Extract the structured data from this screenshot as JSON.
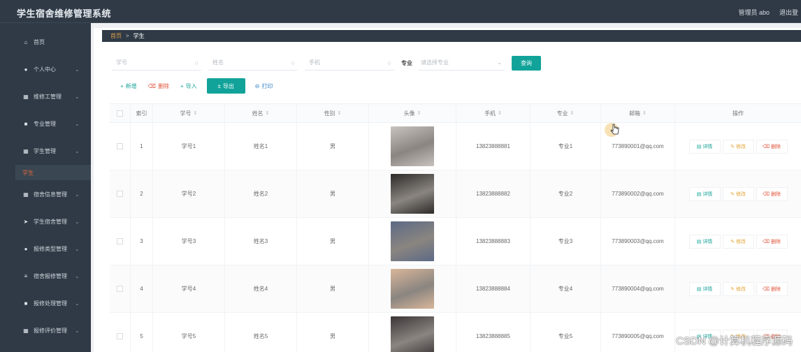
{
  "app": {
    "title": "学生宿舍维修管理系统",
    "user_label": "管理员 abo",
    "logout_label": "退出登"
  },
  "sidebar": {
    "items": [
      {
        "icon": "home-icon",
        "glyph": "⌂",
        "label": "首页",
        "has_chevron": false
      },
      {
        "icon": "user-icon",
        "glyph": "●",
        "label": "个人中心",
        "has_chevron": true
      },
      {
        "icon": "grid-icon",
        "glyph": "▦",
        "label": "维修工管理",
        "has_chevron": true
      },
      {
        "icon": "briefcase-icon",
        "glyph": "■",
        "label": "专业管理",
        "has_chevron": true
      },
      {
        "icon": "grid-icon",
        "glyph": "▦",
        "label": "学生管理",
        "has_chevron": true
      },
      {
        "icon": "grid-icon",
        "glyph": "▦",
        "label": "宿舍信息管理",
        "has_chevron": true
      },
      {
        "icon": "send-icon",
        "glyph": "➤",
        "label": "学生宿舍管理",
        "has_chevron": true
      },
      {
        "icon": "bulb-icon",
        "glyph": "●",
        "label": "报修类型管理",
        "has_chevron": true
      },
      {
        "icon": "list-icon",
        "glyph": "≡",
        "label": "宿舍报修管理",
        "has_chevron": true
      },
      {
        "icon": "chat-icon",
        "glyph": "■",
        "label": "报修处理管理",
        "has_chevron": true
      },
      {
        "icon": "grid-icon",
        "glyph": "▦",
        "label": "报修评价管理",
        "has_chevron": true
      }
    ],
    "active_sub": "学生"
  },
  "breadcrumb": {
    "home": "首页",
    "separator": ">",
    "current": "学生"
  },
  "search": {
    "student_no_placeholder": "学号",
    "name_placeholder": "姓名",
    "phone_placeholder": "手机",
    "major_label": "专业",
    "major_placeholder": "请选择专业",
    "query_label": "查询"
  },
  "actions": {
    "add": "新增",
    "delete": "删除",
    "import": "导入",
    "export": "导出",
    "print": "打印"
  },
  "table": {
    "headers": {
      "index": "索引",
      "student_no": "学号",
      "name": "姓名",
      "gender": "性别",
      "avatar": "头像",
      "phone": "手机",
      "major": "专业",
      "email": "邮箱",
      "ops": "操作"
    },
    "op_labels": {
      "detail": "详情",
      "edit": "修改",
      "remove": "删除"
    },
    "rows": [
      {
        "index": "1",
        "student_no": "学号1",
        "name": "姓名1",
        "gender": "男",
        "phone": "13823888881",
        "major": "专业1",
        "email": "773890001@qq.com",
        "avatar_color": "#c8c3be"
      },
      {
        "index": "2",
        "student_no": "学号2",
        "name": "姓名2",
        "gender": "男",
        "phone": "13823888882",
        "major": "专业2",
        "email": "773890002@qq.com",
        "avatar_color": "#2d2a28"
      },
      {
        "index": "3",
        "student_no": "学号3",
        "name": "姓名3",
        "gender": "男",
        "phone": "13823888883",
        "major": "专业3",
        "email": "773890003@qq.com",
        "avatar_color": "#5c6a86"
      },
      {
        "index": "4",
        "student_no": "学号4",
        "name": "姓名4",
        "gender": "男",
        "phone": "13823888884",
        "major": "专业4",
        "email": "773890004@qq.com",
        "avatar_color": "#d9b69a"
      },
      {
        "index": "5",
        "student_no": "学号5",
        "name": "姓名5",
        "gender": "男",
        "phone": "13823888885",
        "major": "专业5",
        "email": "773890005@qq.com",
        "avatar_color": "#3b3536"
      }
    ]
  },
  "watermark": "CSDN @计算机程序源码"
}
